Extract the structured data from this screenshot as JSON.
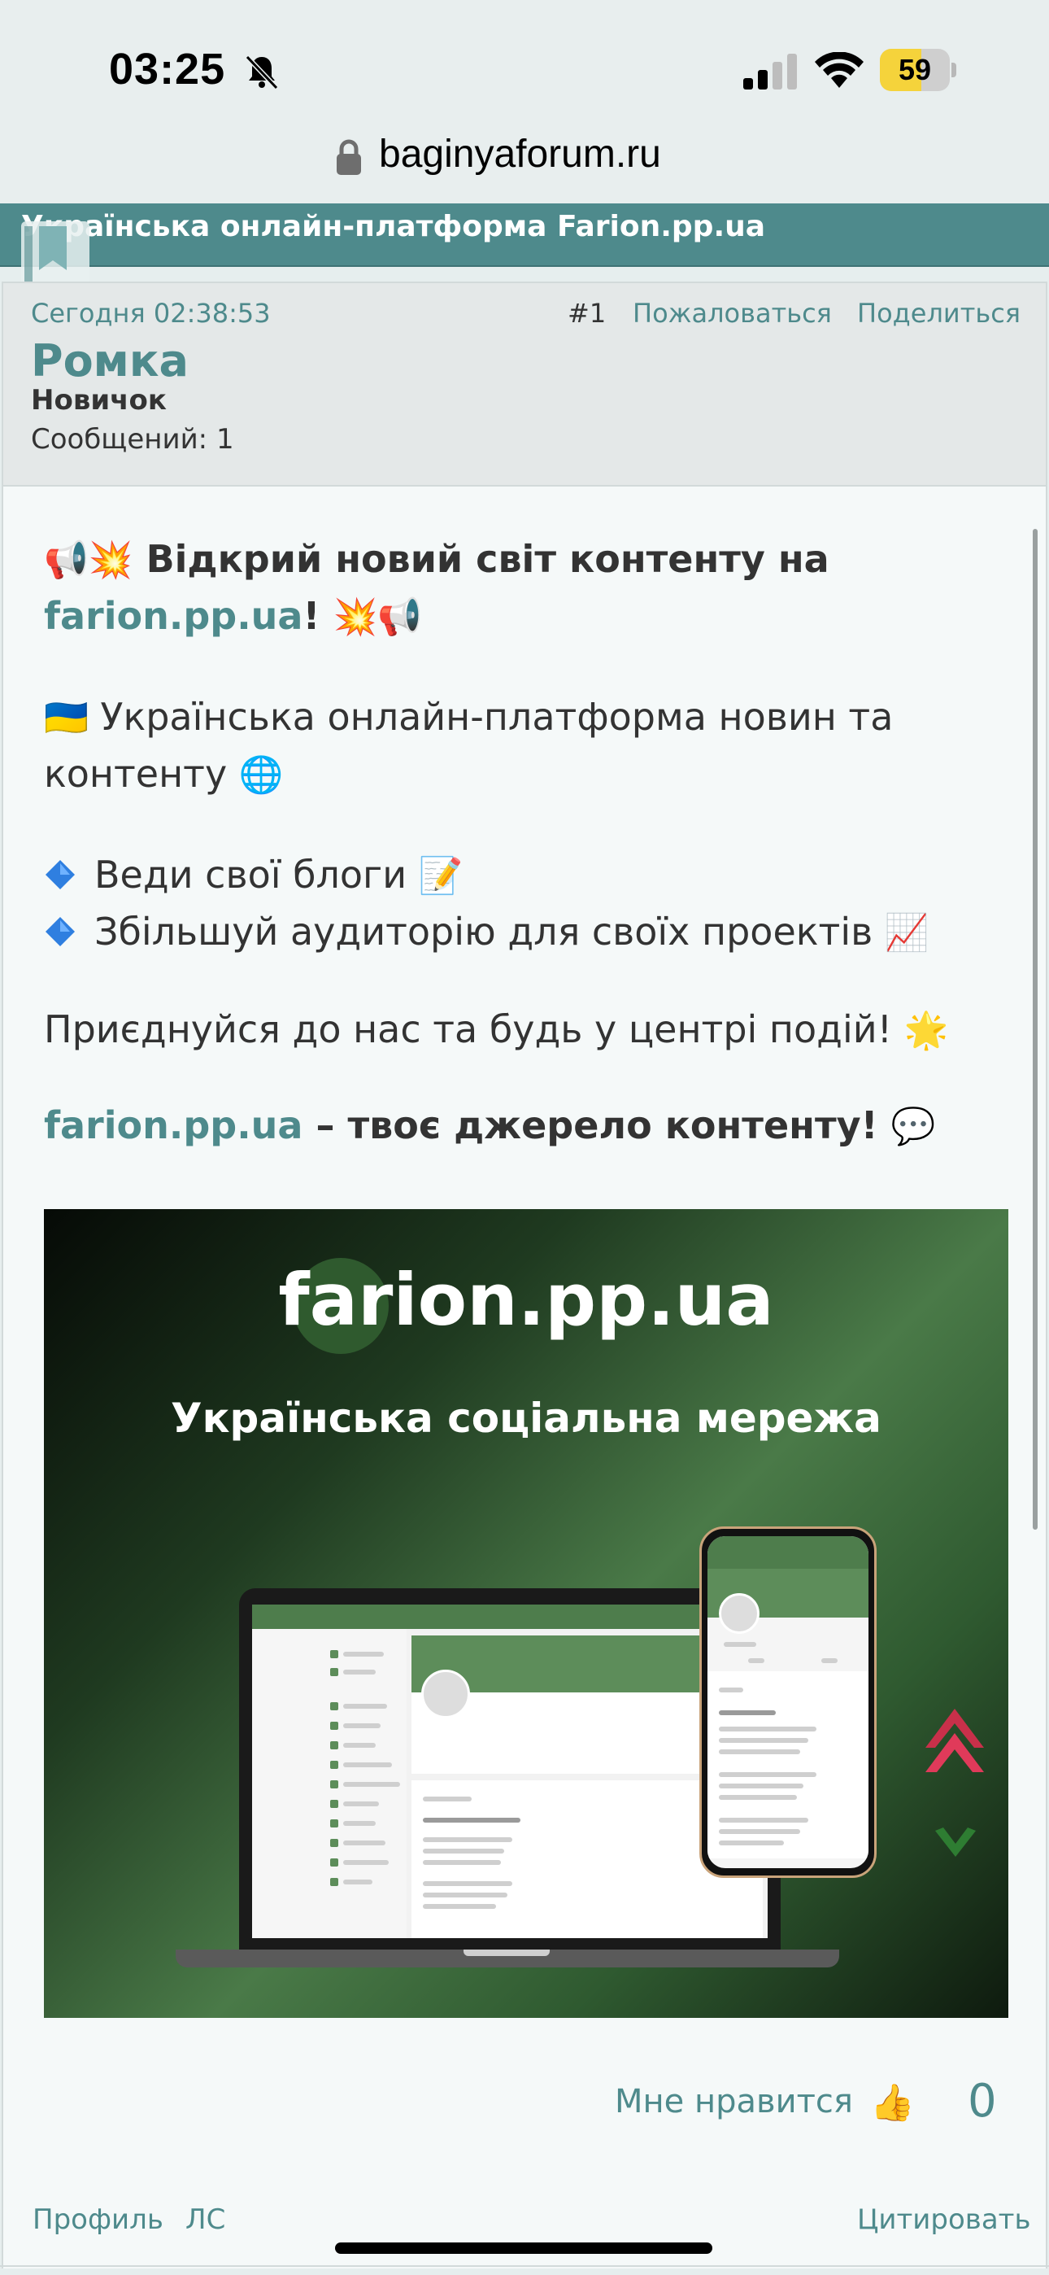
{
  "status_bar": {
    "time": "03:25",
    "battery": "59",
    "battery_level": 0.59
  },
  "browser": {
    "url": "baginyaforum.ru"
  },
  "forum": {
    "banner_title": "Українська онлайн-платформа Farion.pp.ua"
  },
  "post": {
    "timestamp": "Сегодня 02:38:53",
    "number": "#1",
    "report_label": "Пожаловаться",
    "share_label": "Поделиться",
    "author": "Ромка",
    "rank": "Новичок",
    "messages": "Сообщений: 1"
  },
  "content": {
    "headline_emoji_pre": "📢💥",
    "headline_text": "Відкрий новий світ контенту на",
    "headline_link": "farion.pp.ua",
    "headline_end": "!",
    "headline_emoji_post": "💥📢",
    "flag_emoji": "🇺🇦",
    "intro_line1": "Українська онлайн-платформа новин та",
    "intro_line2": "контенту",
    "globe_emoji": "🌐",
    "bullet1": "Веди свої блоги",
    "bullet1_emoji": "📝",
    "bullet2": "Збільшуй аудиторію для своїх проектів",
    "bullet2_emoji": "📈",
    "cta": "Приєднуйся до нас та будь у центрі подій!",
    "cta_emoji": "🌟",
    "closing_link": "farion.pp.ua",
    "closing_text": "– твоє джерело контенту!",
    "closing_emoji": "💬"
  },
  "promo_image": {
    "title": "farion.pp.ua",
    "subtitle": "Українська соціальна мережа"
  },
  "reactions": {
    "like_label": "Мне нравится",
    "like_emoji": "👍",
    "like_count": "0"
  },
  "footer": {
    "profile_label": "Профиль",
    "pm_label": "ЛС",
    "quote_label": "Цитировать"
  },
  "colors": {
    "accent": "#4e8a8c",
    "banner": "#4e8a8c",
    "promo_green": "#4a7a48",
    "arrow_up": "#c8304a",
    "arrow_down": "#2e7d32"
  }
}
